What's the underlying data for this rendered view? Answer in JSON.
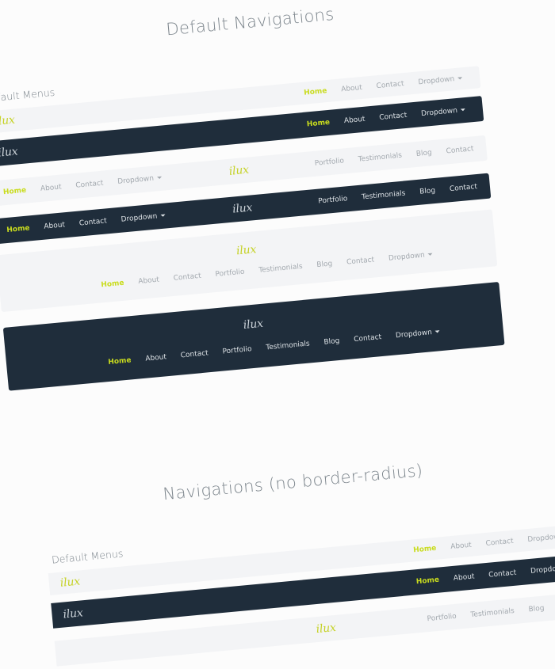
{
  "section1": {
    "title": "Default Navigations",
    "label": "Default Menus"
  },
  "section2": {
    "title": "Navigations (no border-radius)",
    "label": "Default Menus"
  },
  "brand": "ilux",
  "menu_basic": {
    "home": "Home",
    "about": "About",
    "contact": "Contact",
    "dropdown": "Dropdown"
  },
  "menu_right": {
    "portfolio": "Portfolio",
    "testimonials": "Testimonials",
    "blog": "Blog",
    "contact": "Contact"
  },
  "menu_full": {
    "home": "Home",
    "about": "About",
    "contact": "Contact",
    "portfolio": "Portfolio",
    "testimonials": "Testimonials",
    "blog": "Blog",
    "contact2": "Contact",
    "dropdown": "Dropdown"
  },
  "colors": {
    "background": "#fcfcfc",
    "light_nav": "#f3f4f6",
    "dark_nav": "#1f2d3b",
    "accent": "#c9dc1e",
    "text_muted": "#a3a9af"
  }
}
